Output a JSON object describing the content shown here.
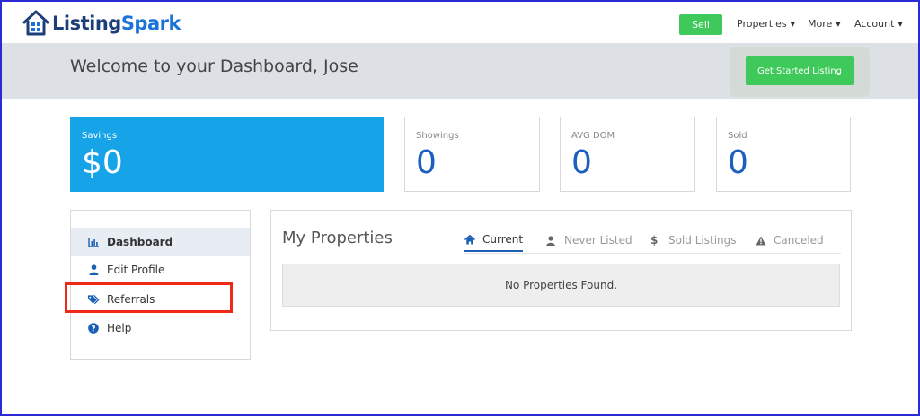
{
  "brand": {
    "name_part1": "Listing",
    "name_part2": "Spark",
    "primary_color": "#1c3f7a",
    "accent_color": "#1a73d9"
  },
  "nav": {
    "sell_label": "Sell",
    "items": [
      {
        "label": "Properties"
      },
      {
        "label": "More"
      },
      {
        "label": "Account"
      }
    ]
  },
  "welcome": {
    "title": "Welcome to your Dashboard, Jose",
    "cta_label": "Get Started Listing"
  },
  "stats": [
    {
      "label": "Savings",
      "value": "$0"
    },
    {
      "label": "Showings",
      "value": "0"
    },
    {
      "label": "AVG DOM",
      "value": "0"
    },
    {
      "label": "Sold",
      "value": "0"
    }
  ],
  "sidebar": {
    "items": [
      {
        "label": "Dashboard",
        "icon": "bar-chart-icon",
        "active": true
      },
      {
        "label": "Edit Profile",
        "icon": "user-icon",
        "active": false
      },
      {
        "label": "Referrals",
        "icon": "tags-icon",
        "active": false
      },
      {
        "label": "Help",
        "icon": "question-circle-icon",
        "active": false
      }
    ]
  },
  "properties": {
    "title": "My Properties",
    "tabs": [
      {
        "label": "Current",
        "icon": "home-icon",
        "active": true
      },
      {
        "label": "Never Listed",
        "icon": "user-icon",
        "active": false
      },
      {
        "label": "Sold Listings",
        "icon": "dollar-icon",
        "active": false
      },
      {
        "label": "Canceled",
        "icon": "warning-icon",
        "active": false
      }
    ],
    "empty_message": "No Properties Found."
  },
  "colors": {
    "green": "#3fc95b",
    "savings_bg": "#17a3e8",
    "stat_value": "#1c5fbf",
    "highlight": "#ee2a17"
  }
}
